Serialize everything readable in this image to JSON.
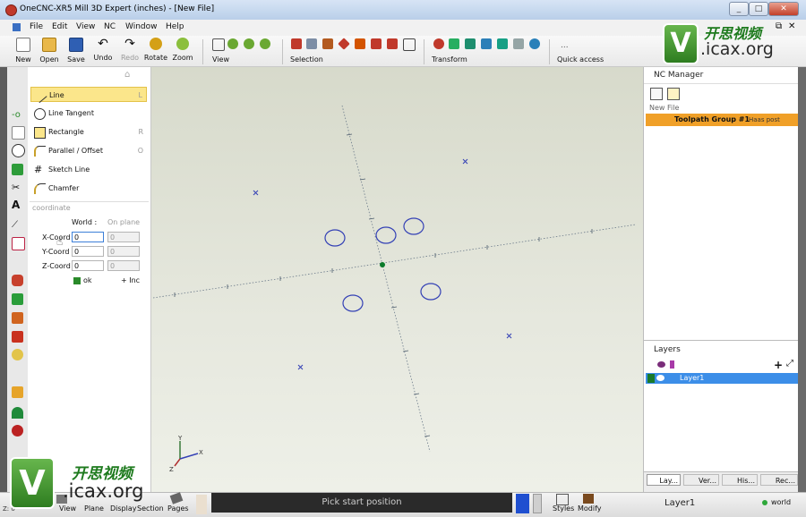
{
  "window": {
    "title": "OneCNC-XR5 Mill 3D Expert (inches) - [New File]",
    "min": "_",
    "max": "□",
    "close": "✕"
  },
  "menu": [
    "File",
    "Edit",
    "View",
    "NC",
    "Window",
    "Help"
  ],
  "menu_doc_controls": {
    "restore": "⧉",
    "close": "✕"
  },
  "toolbar": {
    "buttons": [
      {
        "label": "New",
        "icon": "new-file-icon",
        "color": "#ffffff"
      },
      {
        "label": "Open",
        "icon": "open-folder-icon",
        "color": "#e9b84a"
      },
      {
        "label": "Save",
        "icon": "save-disk-icon",
        "color": "#2f5fb3"
      },
      {
        "label": "Undo",
        "icon": "undo-arrow-icon",
        "color": "#222222"
      },
      {
        "label": "Redo",
        "icon": "redo-arrow-icon",
        "color": "#222222"
      },
      {
        "label": "Rotate",
        "icon": "rotate-icon",
        "color": "#d4a017"
      },
      {
        "label": "Zoom",
        "icon": "zoom-icon",
        "color": "#8bbf3d"
      }
    ],
    "groups": {
      "view": "View",
      "selection": "Selection",
      "transform": "Transform",
      "quick": "Quick access",
      "quick_more": "..."
    }
  },
  "left_tools": [
    "point-icon",
    "line-icon",
    "circle-icon",
    "rectangle-fill-icon",
    "trim-icon",
    "text-icon",
    "dimension-icon",
    "polygon-icon",
    "solid-icon",
    "box-icon",
    "extrude-icon",
    "surface-icon",
    "mesh-icon",
    "fixture-icon",
    "tool-icon",
    "gear-icon"
  ],
  "command_panel": {
    "home_hint": "⌂",
    "items": [
      {
        "label": "Line",
        "key": "L",
        "icon": "line-icon",
        "selected": true
      },
      {
        "label": "Line Tangent",
        "key": "",
        "icon": "line-tangent-icon",
        "selected": false
      },
      {
        "label": "Rectangle",
        "key": "R",
        "icon": "rectangle-icon",
        "selected": false
      },
      {
        "label": "Parallel / Offset",
        "key": "O",
        "icon": "parallel-offset-icon",
        "selected": false
      },
      {
        "label": "Sketch Line",
        "key": "",
        "icon": "sketch-line-icon",
        "selected": false
      },
      {
        "label": "Chamfer",
        "key": "",
        "icon": "chamfer-icon",
        "selected": false
      }
    ],
    "coordinate_title": "coordinate",
    "world_label": "World :",
    "onplane_label": "On plane",
    "coords": [
      {
        "label": "X-Coord",
        "world": "0",
        "plane": "0"
      },
      {
        "label": "Y-Coord",
        "world": "0",
        "plane": "0"
      },
      {
        "label": "Z-Coord",
        "world": "0",
        "plane": "0"
      }
    ],
    "ok_label": "ok",
    "inc_label": "+ Inc"
  },
  "nc_manager": {
    "title": "NC Manager",
    "file_label": "New File",
    "group_label": "Toolpath Group #1",
    "post_label": "Haas post",
    "group_color": "#f0a028"
  },
  "layers": {
    "title": "Layers",
    "layer_name": "Layer1",
    "selected_color": "#3c8ee8",
    "add": "+",
    "expand": "⤢"
  },
  "right_tabs": [
    "Lay...",
    "Ver...",
    "His...",
    "Rec..."
  ],
  "status": {
    "prompt": "Pick start position",
    "bottom_buttons": [
      "View",
      "Plane",
      "Display",
      "Section",
      "Pages"
    ],
    "right_buttons": [
      "Styles",
      "Modify"
    ],
    "layer": "Layer1",
    "coordsys": "world",
    "corner": "Z: 0"
  },
  "watermark": {
    "v": "V",
    "cn": "开思视频",
    "site": ".icax.org"
  },
  "viewport": {
    "axis_triad": [
      "X",
      "Y",
      "Z"
    ]
  }
}
